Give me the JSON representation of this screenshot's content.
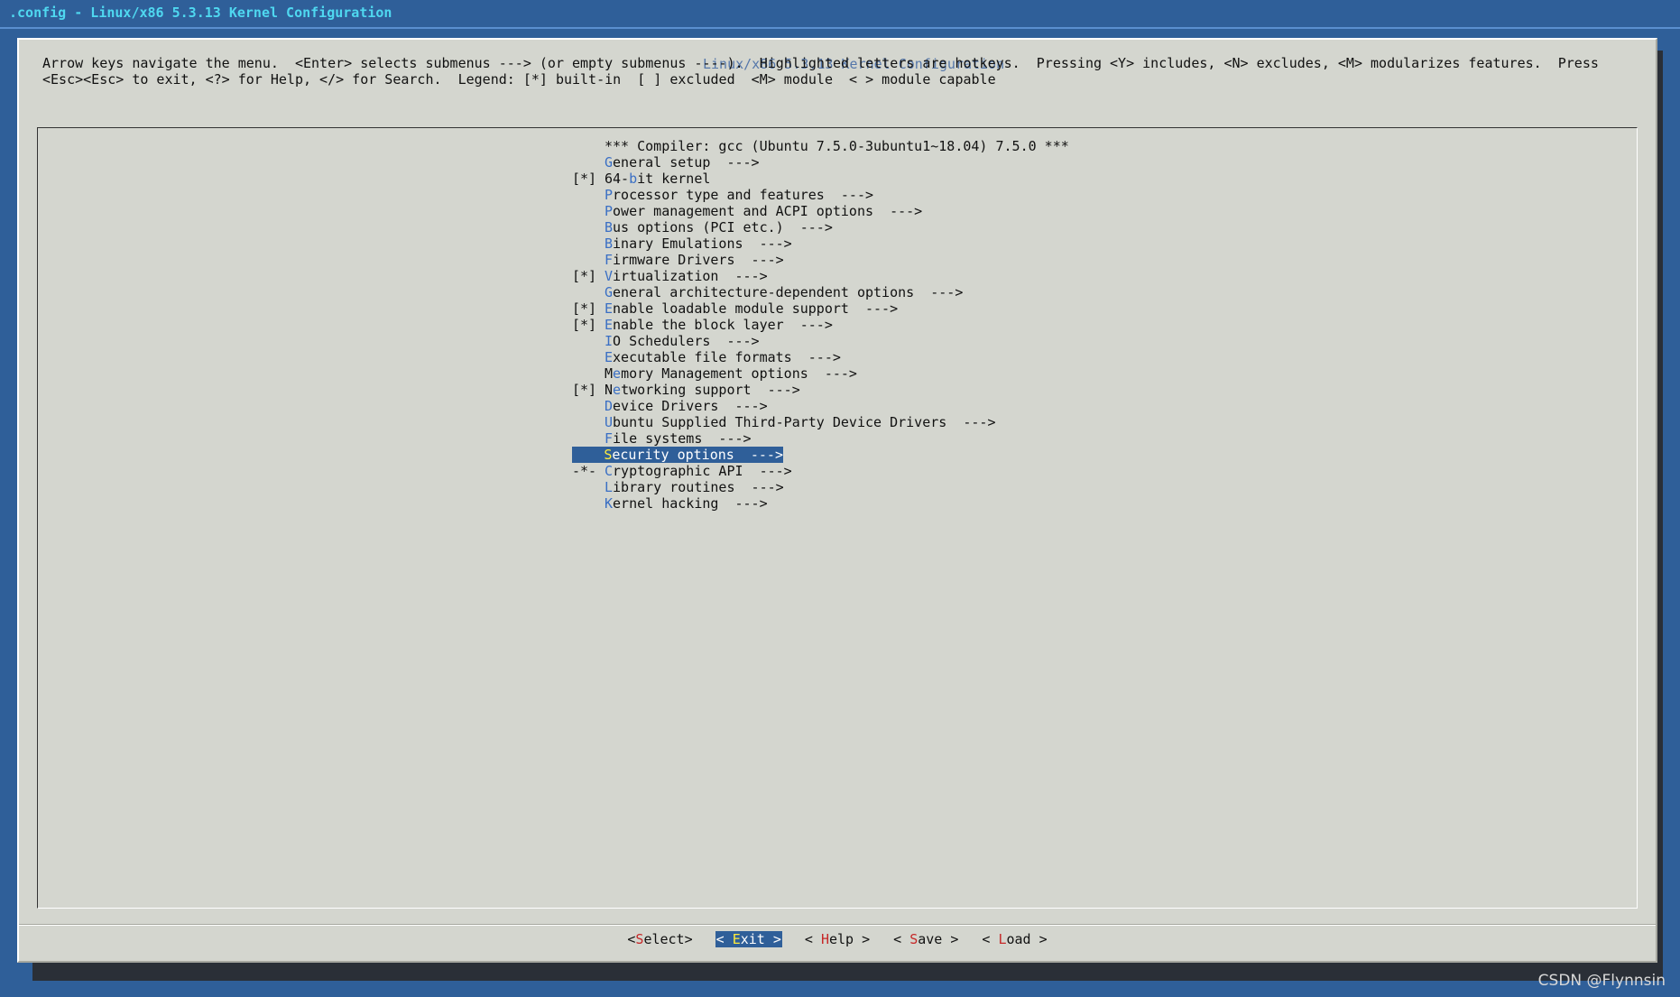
{
  "window": {
    "title": ".config - Linux/x86 5.3.13 Kernel Configuration"
  },
  "dialog": {
    "title": "Linux/x86 5.3.13 Kernel Configuration",
    "instructions": [
      "Arrow keys navigate the menu.  <Enter> selects submenus ---> (or empty submenus ----).  Highlighted letters are hotkeys.  Pressing <Y> includes, <N> excludes, <M> modularizes features.  Press",
      "<Esc><Esc> to exit, <?> for Help, </> for Search.  Legend: [*] built-in  [ ] excluded  <M> module  < > module capable"
    ]
  },
  "menu": {
    "items": [
      {
        "mark": "",
        "before": "",
        "hot": "",
        "after": "*** Compiler: gcc (Ubuntu 7.5.0-3ubuntu1~18.04) 7.5.0 ***",
        "selected": false
      },
      {
        "mark": "",
        "before": "",
        "hot": "G",
        "after": "eneral setup  --->",
        "selected": false
      },
      {
        "mark": "[*]",
        "before": "64-",
        "hot": "b",
        "after": "it kernel",
        "selected": false
      },
      {
        "mark": "",
        "before": "",
        "hot": "P",
        "after": "rocessor type and features  --->",
        "selected": false
      },
      {
        "mark": "",
        "before": "",
        "hot": "P",
        "after": "ower management and ACPI options  --->",
        "selected": false
      },
      {
        "mark": "",
        "before": "",
        "hot": "B",
        "after": "us options (PCI etc.)  --->",
        "selected": false
      },
      {
        "mark": "",
        "before": "",
        "hot": "B",
        "after": "inary Emulations  --->",
        "selected": false
      },
      {
        "mark": "",
        "before": "",
        "hot": "F",
        "after": "irmware Drivers  --->",
        "selected": false
      },
      {
        "mark": "[*]",
        "before": "",
        "hot": "V",
        "after": "irtualization  --->",
        "selected": false
      },
      {
        "mark": "",
        "before": "",
        "hot": "G",
        "after": "eneral architecture-dependent options  --->",
        "selected": false
      },
      {
        "mark": "[*]",
        "before": "",
        "hot": "E",
        "after": "nable loadable module support  --->",
        "selected": false
      },
      {
        "mark": "[*]",
        "before": "",
        "hot": "E",
        "after": "nable the block layer  --->",
        "selected": false
      },
      {
        "mark": "",
        "before": "",
        "hot": "I",
        "after": "O Schedulers  --->",
        "selected": false
      },
      {
        "mark": "",
        "before": "",
        "hot": "E",
        "after": "xecutable file formats  --->",
        "selected": false
      },
      {
        "mark": "",
        "before": "M",
        "hot": "e",
        "after": "mory Management options  --->",
        "selected": false
      },
      {
        "mark": "[*]",
        "before": "N",
        "hot": "e",
        "after": "tworking support  --->",
        "selected": false
      },
      {
        "mark": "",
        "before": "",
        "hot": "D",
        "after": "evice Drivers  --->",
        "selected": false
      },
      {
        "mark": "",
        "before": "",
        "hot": "U",
        "after": "buntu Supplied Third-Party Device Drivers  --->",
        "selected": false
      },
      {
        "mark": "",
        "before": "",
        "hot": "F",
        "after": "ile systems  --->",
        "selected": false
      },
      {
        "mark": "",
        "before": "",
        "hot": "S",
        "after": "ecurity options  --->",
        "selected": true
      },
      {
        "mark": "-*-",
        "before": "",
        "hot": "C",
        "after": "ryptographic API  --->",
        "selected": false
      },
      {
        "mark": "",
        "before": "",
        "hot": "L",
        "after": "ibrary routines  --->",
        "selected": false
      },
      {
        "mark": "",
        "before": "",
        "hot": "K",
        "after": "ernel hacking  --->",
        "selected": false
      }
    ]
  },
  "buttons": [
    {
      "name": "select",
      "before": "<",
      "hot": "S",
      "after": "elect>",
      "selected": false
    },
    {
      "name": "exit",
      "before": "< ",
      "hot": "E",
      "after": "xit >",
      "selected": true
    },
    {
      "name": "help",
      "before": "< ",
      "hot": "H",
      "after": "elp >",
      "selected": false
    },
    {
      "name": "save",
      "before": "< ",
      "hot": "S",
      "after": "ave >",
      "selected": false
    },
    {
      "name": "load",
      "before": "< ",
      "hot": "L",
      "after": "oad >",
      "selected": false
    }
  ],
  "watermark": "CSDN @Flynnsin",
  "colors": {
    "background": "#2f5f99",
    "dialog": "#d4d6cf",
    "hotkey_menu": "#3a6fc4",
    "hotkey_button": "#c62828",
    "selection": "#2f5f99",
    "title_bar_text": "#4fd8f0"
  }
}
